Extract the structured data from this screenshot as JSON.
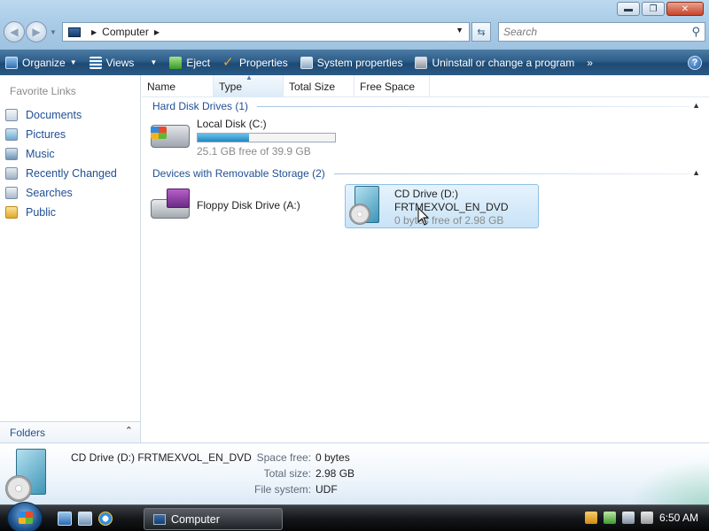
{
  "window": {
    "minimize_glyph": "▬",
    "maximize_glyph": "❐",
    "close_glyph": "✕"
  },
  "address": {
    "location": "Computer"
  },
  "search": {
    "placeholder": "Search"
  },
  "toolbar": {
    "items": [
      {
        "label": "Organize",
        "icon": "organize-icon",
        "has_menu": true
      },
      {
        "label": "Views",
        "icon": "views-icon",
        "has_menu": true
      },
      {
        "label": "Eject",
        "icon": "eject-icon"
      },
      {
        "label": "Properties",
        "icon": "properties-icon"
      },
      {
        "label": "System properties",
        "icon": "system-properties-icon"
      },
      {
        "label": "Uninstall or change a program",
        "icon": "uninstall-icon"
      }
    ],
    "overflow": "»",
    "help": "?"
  },
  "nav": {
    "favorites_title": "Favorite Links",
    "items": [
      {
        "label": "Documents",
        "icon": "documents-icon"
      },
      {
        "label": "Pictures",
        "icon": "pictures-icon"
      },
      {
        "label": "Music",
        "icon": "music-icon"
      },
      {
        "label": "Recently Changed",
        "icon": "recently-changed-icon"
      },
      {
        "label": "Searches",
        "icon": "searches-icon"
      },
      {
        "label": "Public",
        "icon": "public-folder-icon"
      }
    ],
    "folders_label": "Folders"
  },
  "columns": [
    "Name",
    "Type",
    "Total Size",
    "Free Space"
  ],
  "groups": {
    "hdd": {
      "title": "Hard Disk Drives (1)",
      "drives": [
        {
          "name": "Local Disk (C:)",
          "free_text": "25.1 GB free of 39.9 GB",
          "used_fraction": 0.371
        }
      ]
    },
    "removable": {
      "title": "Devices with Removable Storage (2)",
      "drives": [
        {
          "name": "Floppy Disk Drive (A:)"
        },
        {
          "name": "CD Drive (D:)",
          "label": "FRTMEXVOL_EN_DVD",
          "free_text": "0 bytes free of 2.98 GB"
        }
      ]
    }
  },
  "details": {
    "title": "CD Drive (D:) FRTMEXVOL_EN_DVD",
    "props": [
      {
        "label": "Space free:",
        "value": "0 bytes"
      },
      {
        "label": "Total size:",
        "value": "2.98 GB"
      },
      {
        "label": "File system:",
        "value": "UDF"
      }
    ]
  },
  "taskbar": {
    "active_window": "Computer",
    "clock": "6:50 AM"
  },
  "colors": {
    "link_blue": "#1f4f95",
    "toolbar_blue": "#2d5d88",
    "selection": "#c8e3f7"
  }
}
